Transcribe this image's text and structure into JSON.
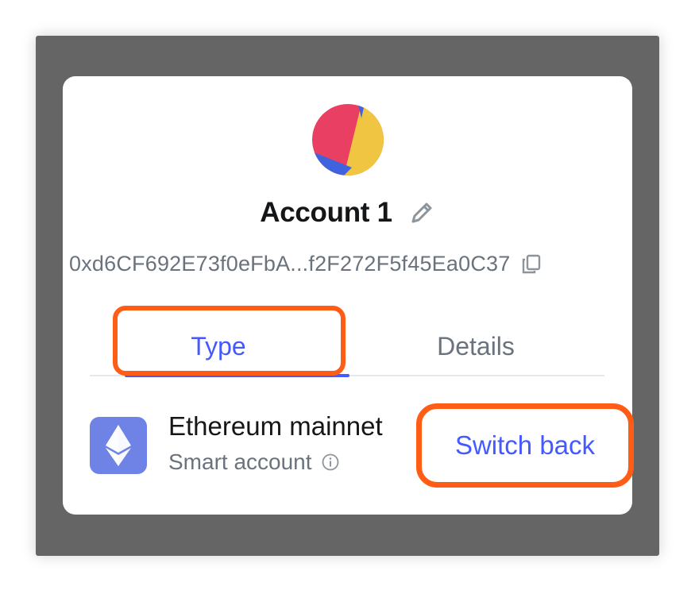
{
  "account": {
    "name": "Account 1",
    "address": "0xd6CF692E73f0eFbA...f2F272F5f45Ea0C37"
  },
  "tabs": [
    {
      "label": "Type",
      "active": true
    },
    {
      "label": "Details",
      "active": false
    }
  ],
  "network": {
    "name": "Ethereum mainnet",
    "account_type": "Smart account",
    "icon": "ethereum-icon"
  },
  "actions": {
    "switch_back_label": "Switch back"
  },
  "colors": {
    "accent": "#4459ff",
    "highlight": "#ff5c16",
    "backdrop": "#656565",
    "network_icon_bg": "#6f83e6"
  },
  "icons": {
    "edit": "pencil-icon",
    "copy": "copy-icon",
    "info": "info-icon"
  }
}
